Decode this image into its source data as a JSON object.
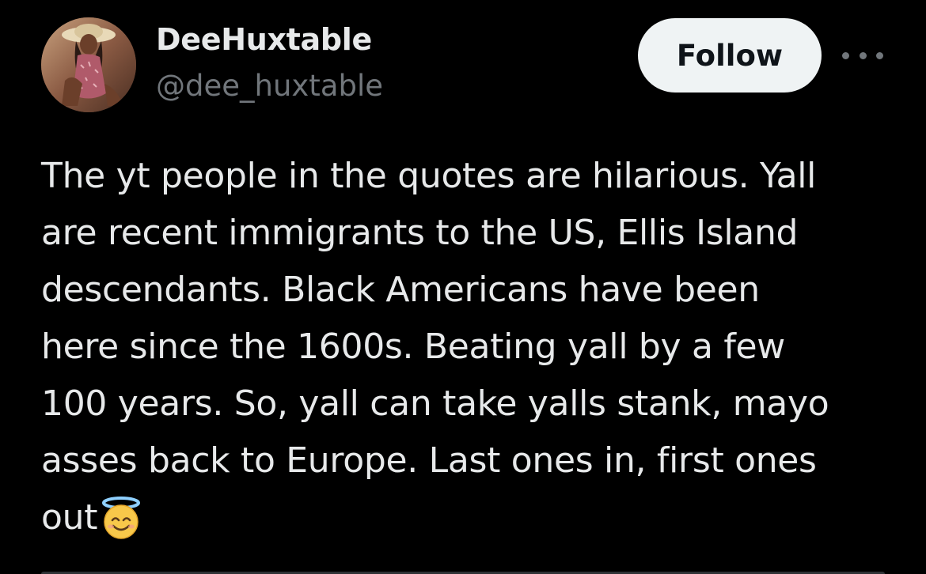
{
  "user": {
    "display_name": "DeeHuxtable",
    "handle": "@dee_huxtable",
    "avatar_icon": "profile-photo"
  },
  "actions": {
    "follow_label": "Follow",
    "more_icon": "more-horizontal-icon"
  },
  "tweet": {
    "lines": [
      "The yt people in the quotes are hilarious.  Yall",
      "are recent immigrants to the US, Ellis Island",
      "descendants. Black Americans have been",
      "here since the 1600s.  Beating yall by a few",
      "100 years.  So, yall can take yalls stank, mayo",
      "asses back to Europe. Last ones in, first ones",
      "out"
    ],
    "trailing_emoji": "smiling-face-with-halo-emoji"
  },
  "colors": {
    "background": "#000000",
    "primary_text": "#e7e9ea",
    "secondary_text": "#71767b",
    "follow_bg": "#eff3f4",
    "follow_text": "#0f1419"
  }
}
